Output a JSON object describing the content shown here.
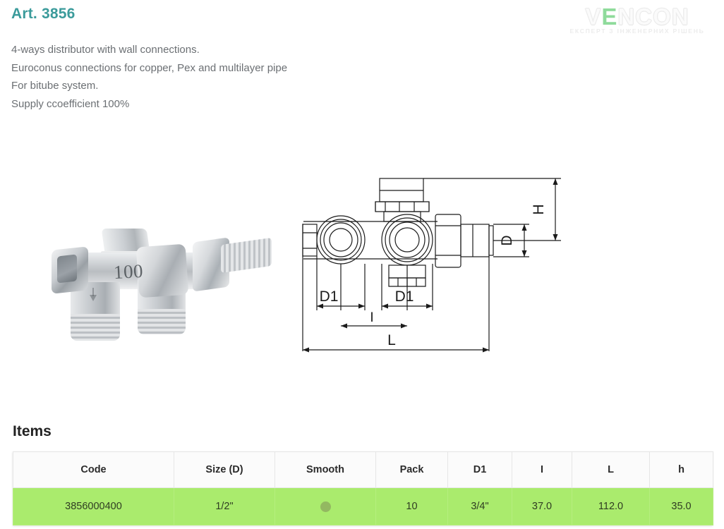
{
  "header": {
    "article_title": "Art. 3856",
    "article_color": "#3b9b9b",
    "description_lines": [
      "4-ways distributor with wall connections.",
      "Euroconus connections for copper, Pex and multilayer pipe",
      "For bitube system.",
      "Supply ccoefficient 100%"
    ]
  },
  "logo": {
    "name_left": "V",
    "name_accent": "E",
    "name_right": "NCON",
    "full_name": "VENCON",
    "tagline": "ЕКСПЕРТ З ІНЖЕНЕРНИХ РІШЕНЬ",
    "accent_color": "#8fdb9b"
  },
  "product_photo": {
    "alt": "4-ways chrome brass distributor valve",
    "engraved_marking": "100"
  },
  "drawing": {
    "labels": {
      "d1_left": "D1",
      "d1_right": "D1",
      "i": "I",
      "l": "L",
      "h": "H",
      "d": "D"
    }
  },
  "items": {
    "section_title": "Items",
    "columns": [
      "Code",
      "Size (D)",
      "Smooth",
      "Pack",
      "D1",
      "I",
      "L",
      "h"
    ],
    "rows": [
      {
        "code": "3856000400",
        "size_d": "1/2\"",
        "smooth": "●",
        "pack": "10",
        "d1": "3/4\"",
        "i": "37.0",
        "l": "112.0",
        "h": "35.0"
      }
    ],
    "row_highlight_color": "#aaeb6d",
    "smooth_dot_color": "#93b861"
  }
}
